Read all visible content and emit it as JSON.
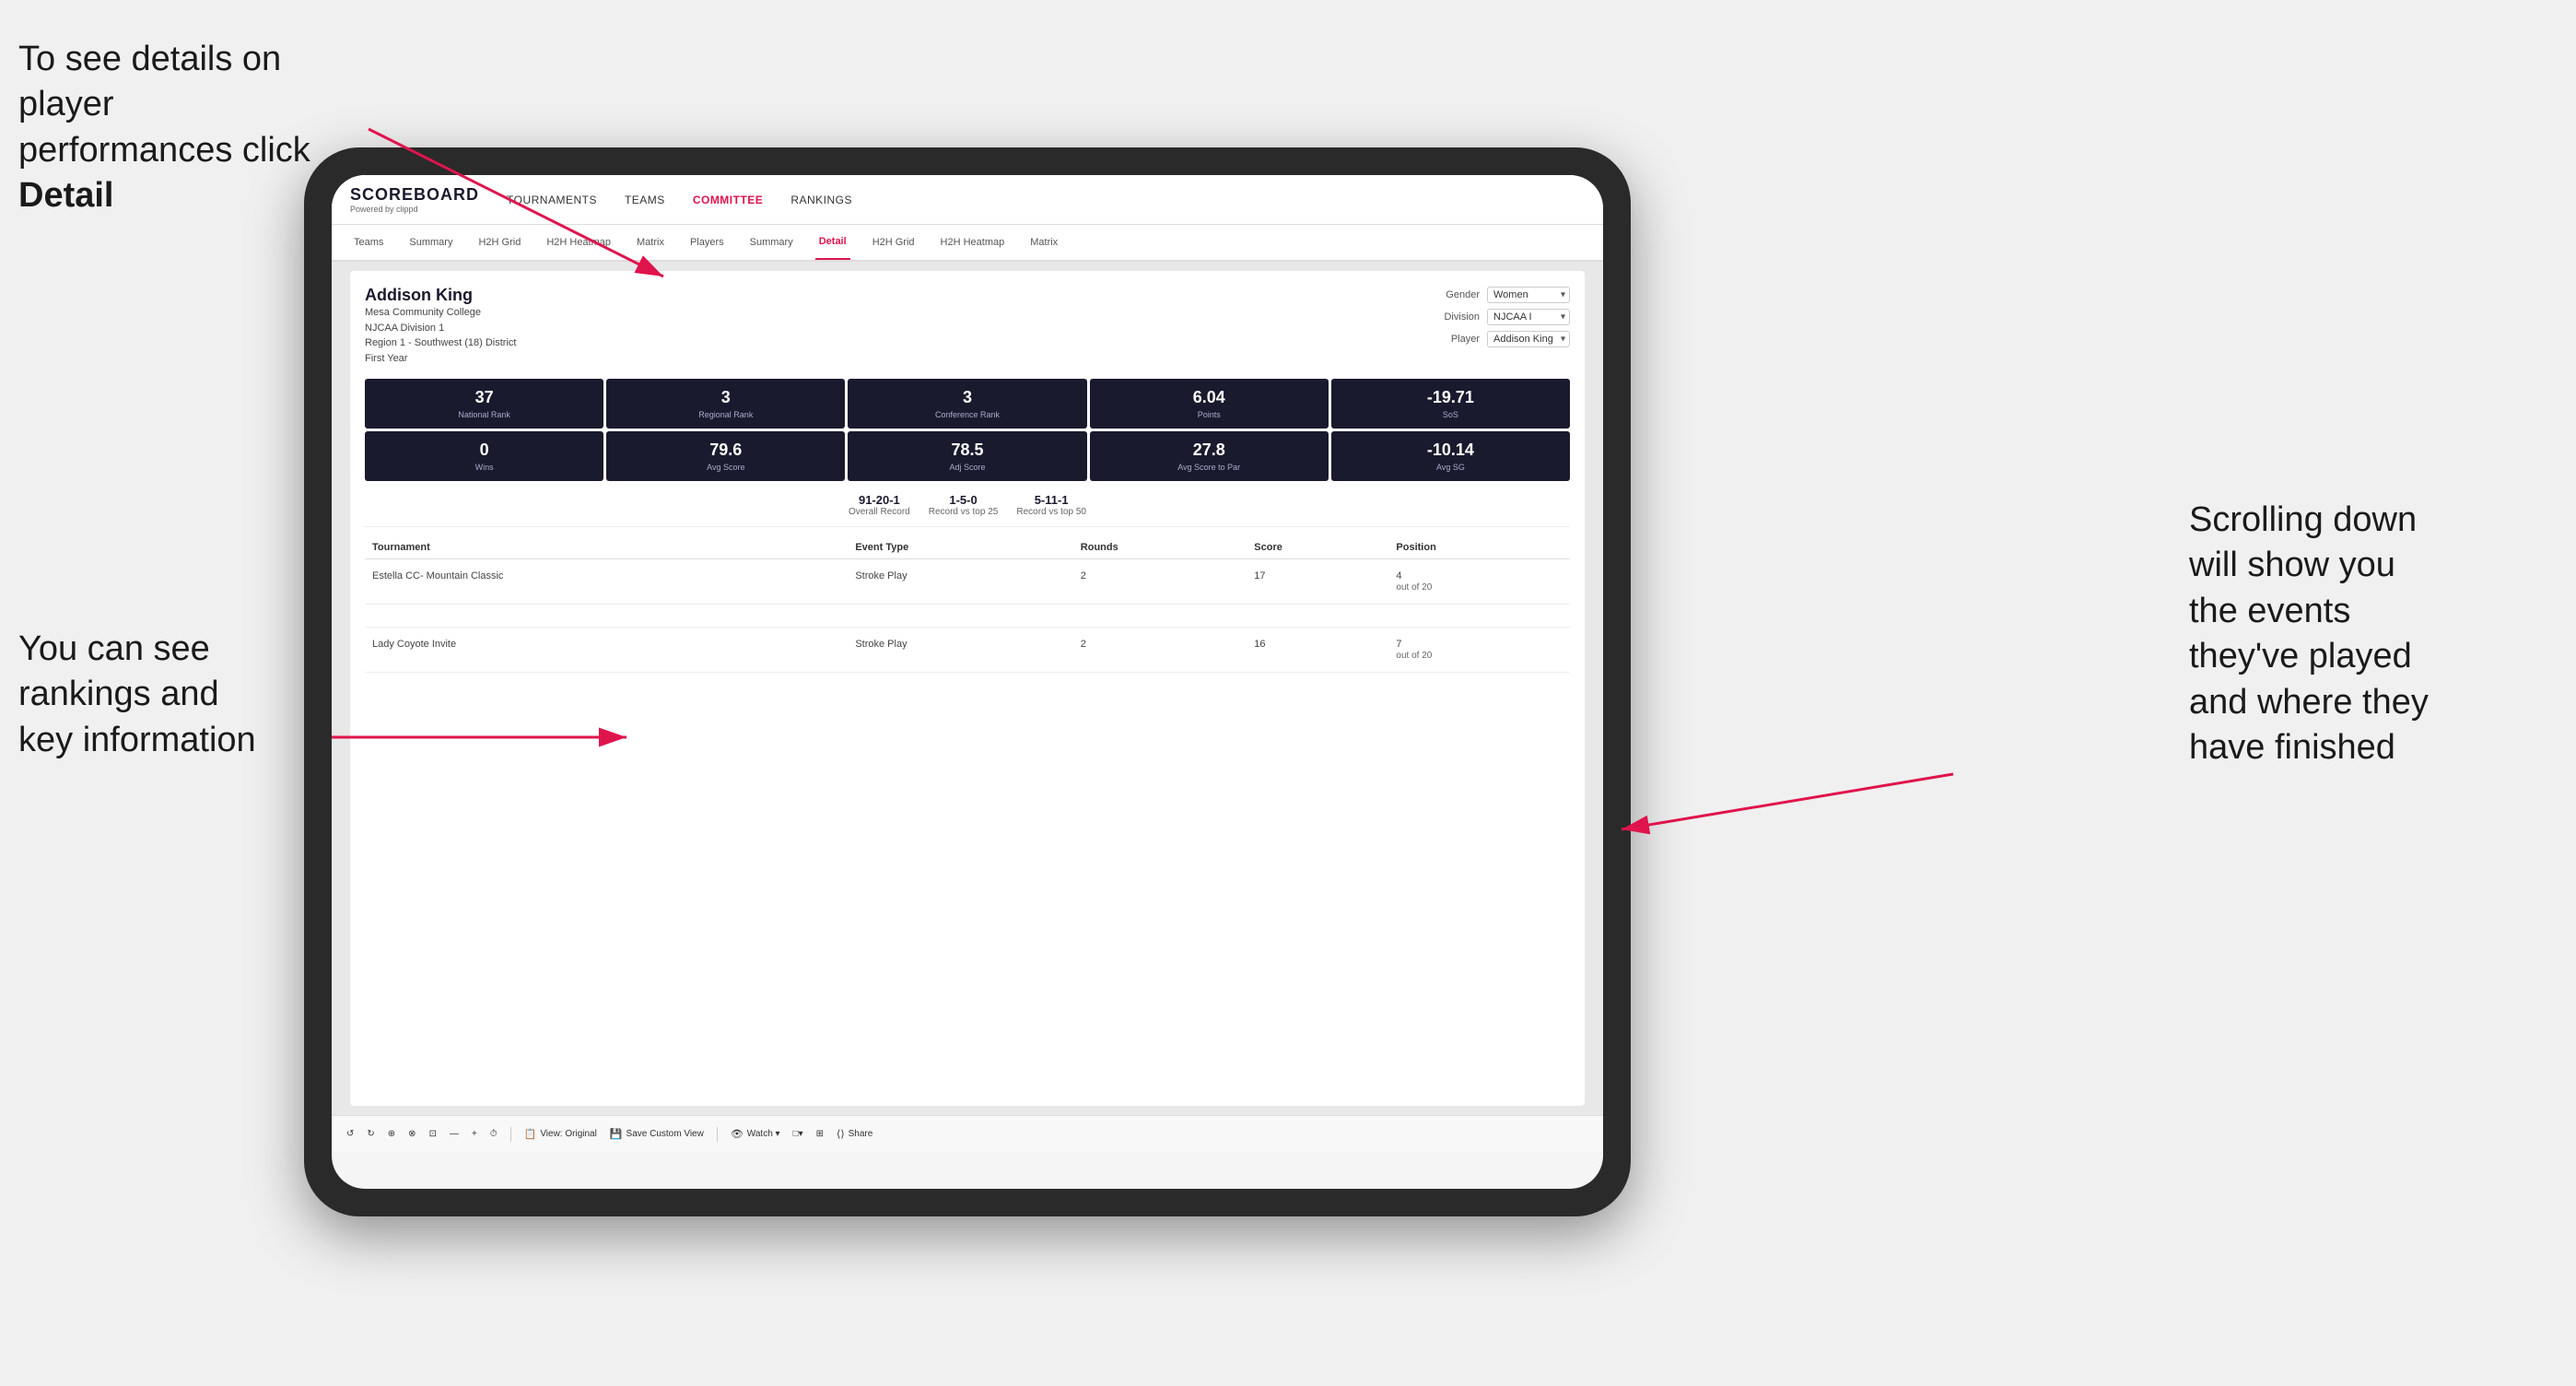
{
  "annotations": {
    "top_left": "To see details on player performances click ",
    "top_left_bold": "Detail",
    "bottom_left_line1": "You can see",
    "bottom_left_line2": "rankings and",
    "bottom_left_line3": "key information",
    "right_line1": "Scrolling down",
    "right_line2": "will show you",
    "right_line3": "the events",
    "right_line4": "they've played",
    "right_line5": "and where they",
    "right_line6": "have finished"
  },
  "header": {
    "logo": "SCOREBOARD",
    "logo_sub": "Powered by clippd",
    "nav": [
      "TOURNAMENTS",
      "TEAMS",
      "COMMITTEE",
      "RANKINGS"
    ]
  },
  "sub_nav": {
    "items": [
      "Teams",
      "Summary",
      "H2H Grid",
      "H2H Heatmap",
      "Matrix",
      "Players",
      "Summary",
      "Detail",
      "H2H Grid",
      "H2H Heatmap",
      "Matrix"
    ]
  },
  "player": {
    "name": "Addison King",
    "college": "Mesa Community College",
    "division": "NJCAA Division 1",
    "region": "Region 1 - Southwest (18) District",
    "year": "First Year",
    "controls": {
      "gender_label": "Gender",
      "gender_value": "Women",
      "division_label": "Division",
      "division_value": "NJCAA I",
      "player_label": "Player",
      "player_value": "Addison King"
    }
  },
  "stats_row1": [
    {
      "value": "37",
      "label": "National Rank"
    },
    {
      "value": "3",
      "label": "Regional Rank"
    },
    {
      "value": "3",
      "label": "Conference Rank"
    },
    {
      "value": "6.04",
      "label": "Points"
    },
    {
      "value": "-19.71",
      "label": "SoS"
    }
  ],
  "stats_row2": [
    {
      "value": "0",
      "label": "Wins"
    },
    {
      "value": "79.6",
      "label": "Avg Score"
    },
    {
      "value": "78.5",
      "label": "Adj Score"
    },
    {
      "value": "27.8",
      "label": "Avg Score to Par"
    },
    {
      "value": "-10.14",
      "label": "Avg SG"
    }
  ],
  "records": [
    {
      "value": "91-20-1",
      "label": "Overall Record"
    },
    {
      "value": "1-5-0",
      "label": "Record vs top 25"
    },
    {
      "value": "5-11-1",
      "label": "Record vs top 50"
    }
  ],
  "table": {
    "headers": [
      "Tournament",
      "Event Type",
      "Rounds",
      "Score",
      "Position"
    ],
    "rows": [
      {
        "tournament": "Estella CC- Mountain Classic",
        "event_type": "Stroke Play",
        "rounds": "2",
        "score": "17",
        "position": "4\nout of 20"
      },
      {
        "tournament": "",
        "event_type": "",
        "rounds": "",
        "score": "",
        "position": ""
      },
      {
        "tournament": "Lady Coyote Invite",
        "event_type": "Stroke Play",
        "rounds": "2",
        "score": "16",
        "position": "7\nout of 20"
      }
    ]
  },
  "toolbar": {
    "items": [
      "↺",
      "↻",
      "⊕",
      "⊗",
      "⊡",
      "—",
      "+",
      "⏱",
      "View: Original",
      "Save Custom View",
      "Watch ▾",
      "□▾",
      "⊞",
      "Share"
    ]
  }
}
